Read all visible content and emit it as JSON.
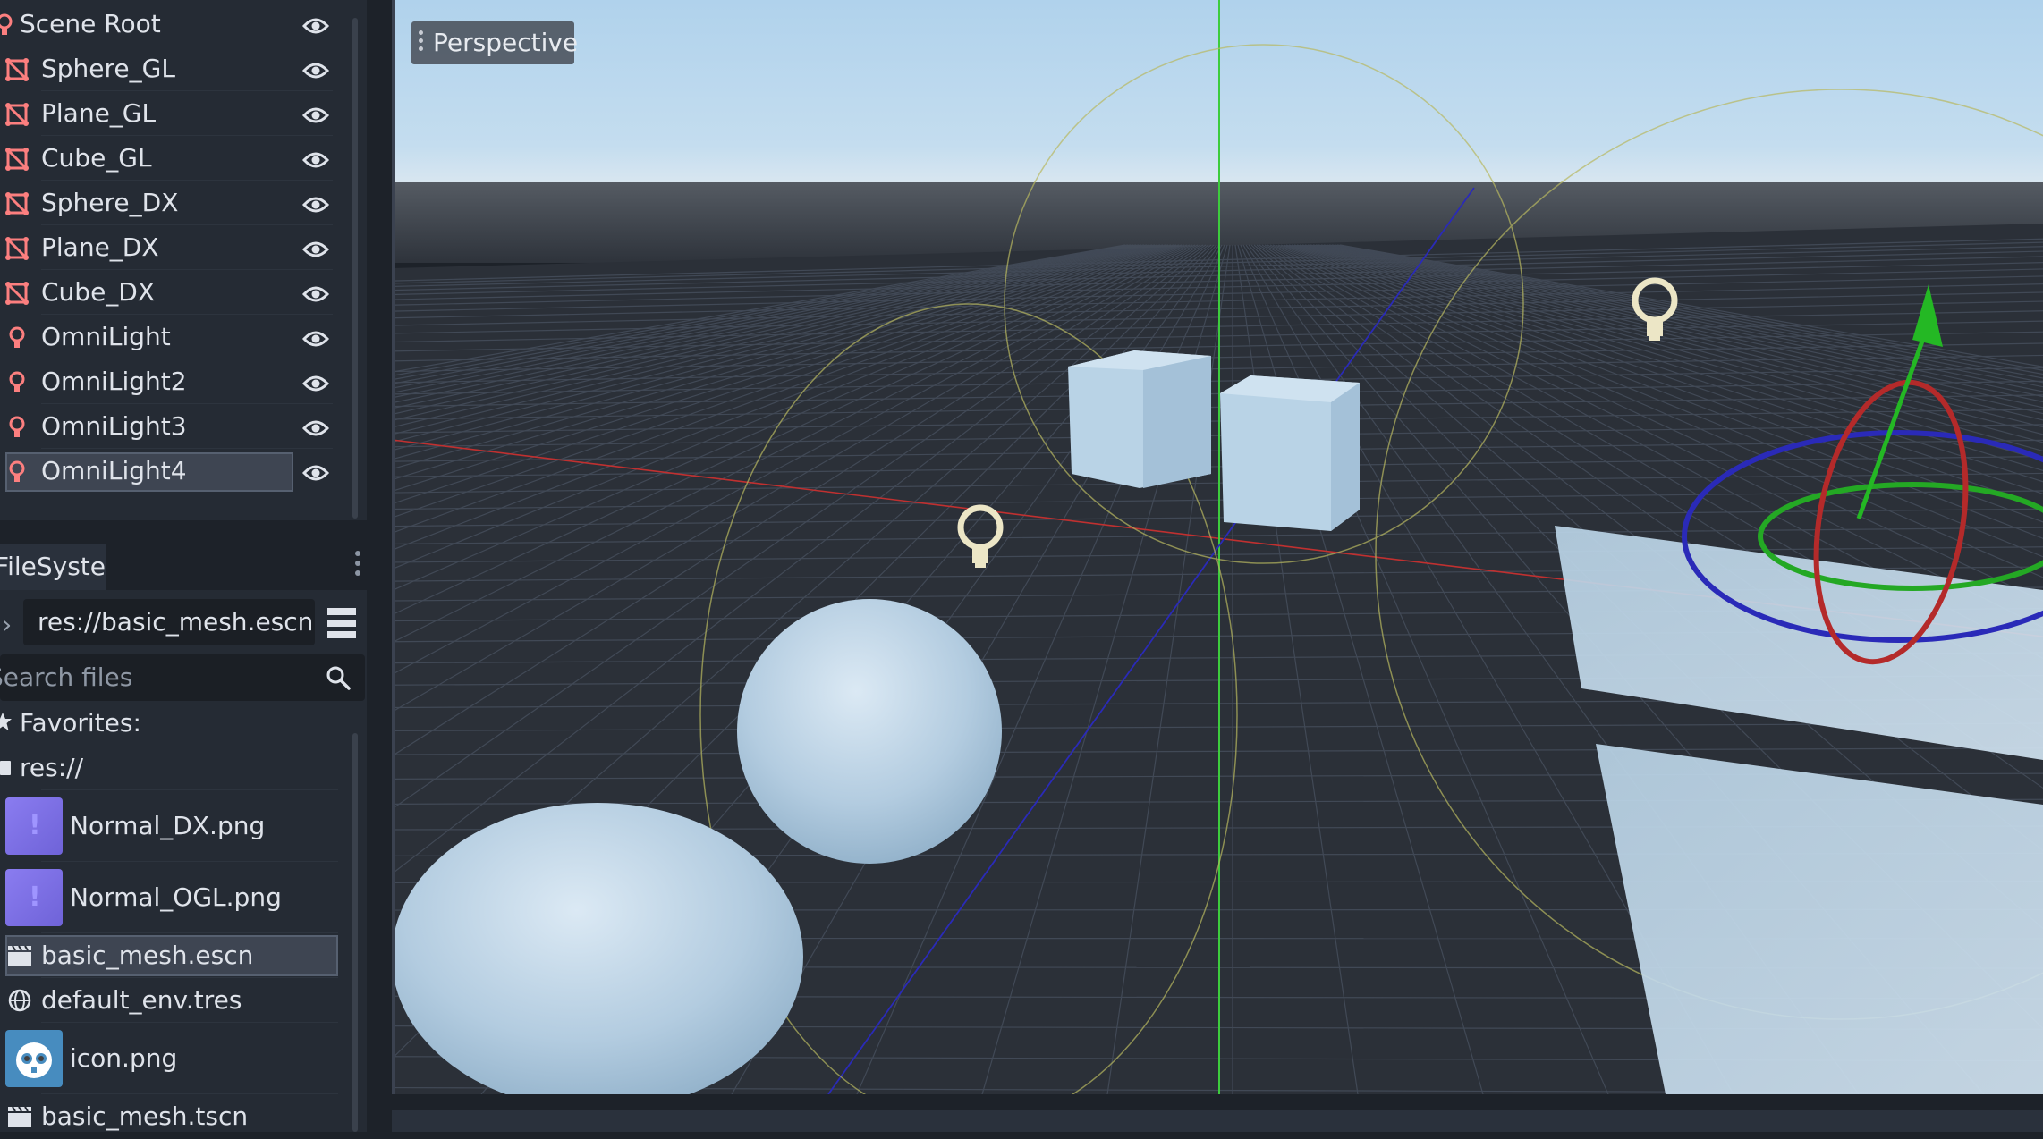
{
  "scene_tree": {
    "nodes": [
      {
        "label": "Scene Root",
        "icon": "omnilight-icon",
        "visible": true
      },
      {
        "label": "Sphere_GL",
        "icon": "mesh-instance-icon",
        "visible": true
      },
      {
        "label": "Plane_GL",
        "icon": "mesh-instance-icon",
        "visible": true
      },
      {
        "label": "Cube_GL",
        "icon": "mesh-instance-icon",
        "visible": true
      },
      {
        "label": "Sphere_DX",
        "icon": "mesh-instance-icon",
        "visible": true
      },
      {
        "label": "Plane_DX",
        "icon": "mesh-instance-icon",
        "visible": true
      },
      {
        "label": "Cube_DX",
        "icon": "mesh-instance-icon",
        "visible": true
      },
      {
        "label": "OmniLight",
        "icon": "omnilight-icon",
        "visible": true
      },
      {
        "label": "OmniLight2",
        "icon": "omnilight-icon",
        "visible": true
      },
      {
        "label": "OmniLight3",
        "icon": "omnilight-icon",
        "visible": true
      },
      {
        "label": "OmniLight4",
        "icon": "omnilight-icon",
        "visible": true,
        "selected": true
      }
    ]
  },
  "filesystem": {
    "tab_label": "FileSystem",
    "path": "res://basic_mesh.escn",
    "search_placeholder": "Search files",
    "favorites_label": "Favorites:",
    "root_label": "res://",
    "files": [
      {
        "label": "Normal_DX.png",
        "icon": "normal-map-thumbnail"
      },
      {
        "label": "Normal_OGL.png",
        "icon": "normal-map-thumbnail"
      },
      {
        "label": "basic_mesh.escn",
        "icon": "scene-clapper-icon",
        "selected": true
      },
      {
        "label": "default_env.tres",
        "icon": "globe-icon"
      },
      {
        "label": "icon.png",
        "icon": "godot-logo-thumbnail"
      },
      {
        "label": "basic_mesh.tscn",
        "icon": "scene-clapper-icon"
      }
    ]
  },
  "viewport": {
    "view_label": "Perspective"
  },
  "colors": {
    "panel_bg": "#252b34",
    "background": "#1d2229",
    "mesh_icon": "#fc7f7f",
    "sky_top": "#b4d6ee",
    "ground": "#2a2f37",
    "axis_x": "#e83434",
    "axis_y": "#30d030",
    "axis_z": "#3434e0",
    "light_gizmo": "#e9e4c4"
  }
}
